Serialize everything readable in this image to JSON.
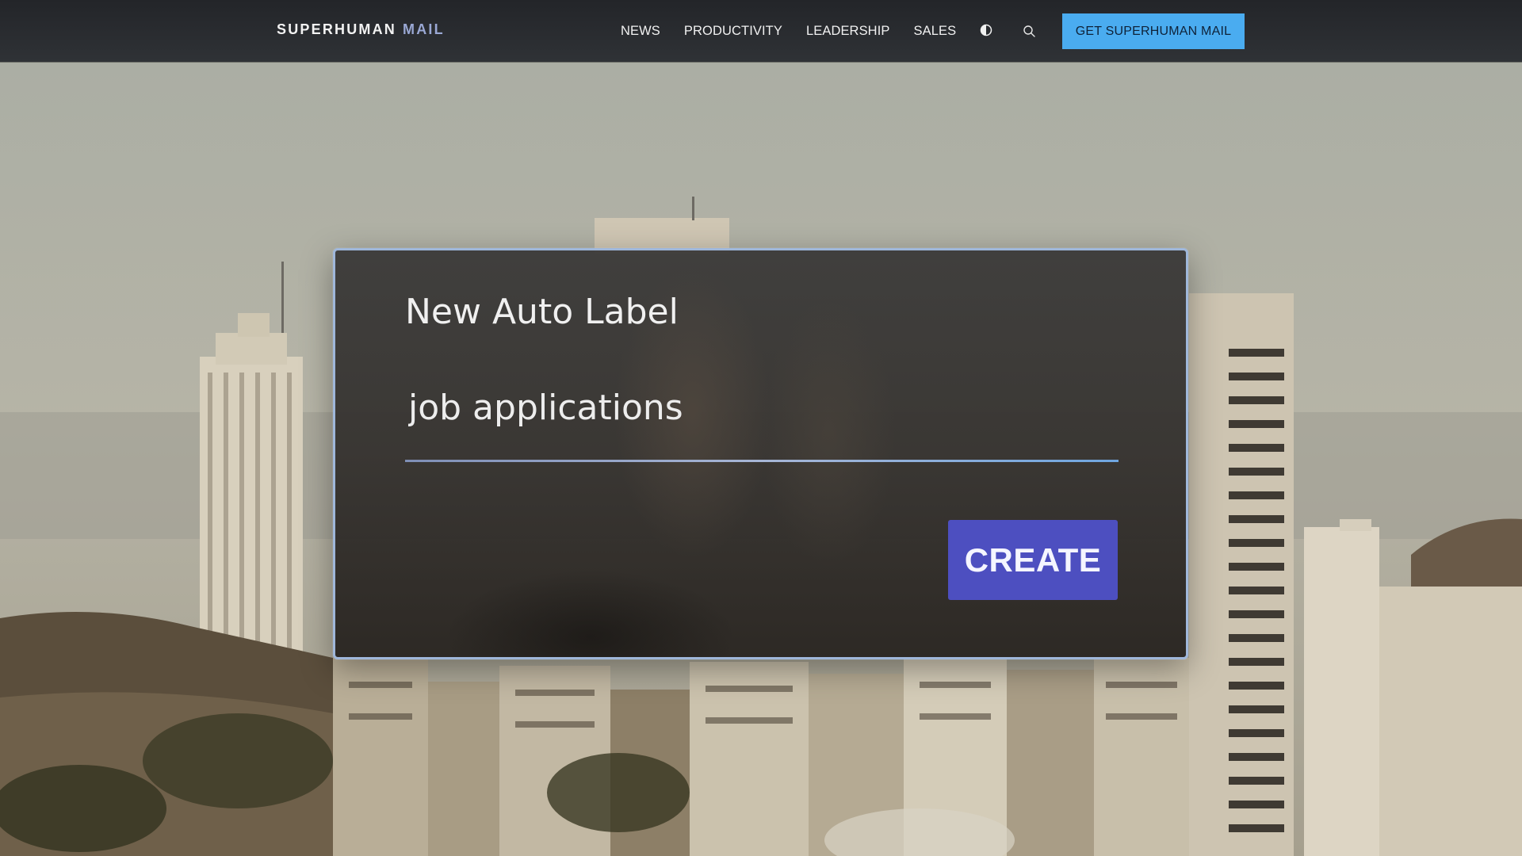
{
  "header": {
    "brand_primary": "SUPERHUMAN",
    "brand_secondary": "MAIL",
    "nav_items": [
      "NEWS",
      "PRODUCTIVITY",
      "LEADERSHIP",
      "SALES"
    ],
    "theme_toggle_icon": "contrast-icon",
    "search_icon": "search-icon",
    "cta_label": "GET SUPERHUMAN MAIL"
  },
  "dialog": {
    "title": "New Auto Label",
    "input_value": "job applications",
    "create_label": "CREATE"
  },
  "colors": {
    "nav_bg": "#2b2d31",
    "cta_bg": "#4aacf0",
    "dialog_border": "#9fb7da",
    "create_bg": "#4d4fc0"
  }
}
